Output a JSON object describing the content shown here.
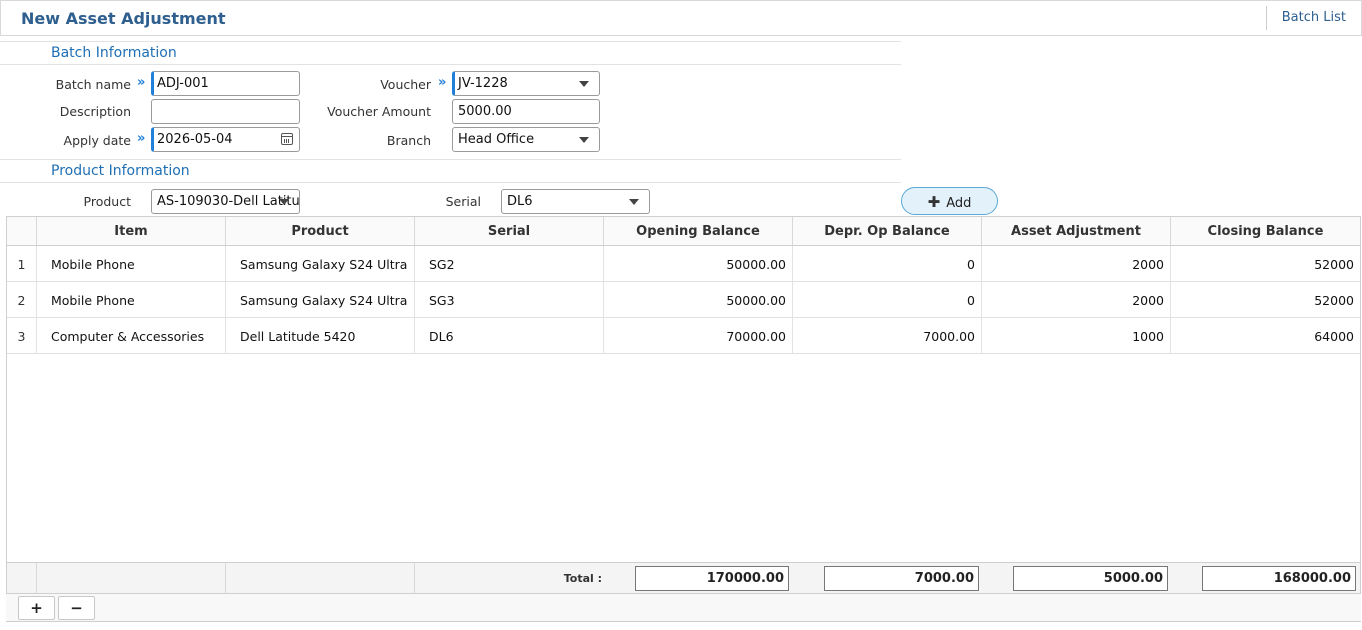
{
  "header": {
    "title": "New Asset Adjustment",
    "batch_list_label": "Batch List"
  },
  "batch_info": {
    "section_title": "Batch Information",
    "batch_name_label": "Batch name",
    "batch_name_value": "ADJ-001",
    "description_label": "Description",
    "description_value": "",
    "apply_date_label": "Apply date",
    "apply_date_value": "2026-05-04",
    "voucher_label": "Voucher",
    "voucher_value": "JV-1228",
    "voucher_amount_label": "Voucher Amount",
    "voucher_amount_value": "5000.00",
    "branch_label": "Branch",
    "branch_value": "Head Office"
  },
  "product_info": {
    "section_title": "Product Information",
    "product_label": "Product",
    "product_value": "AS-109030-Dell Latitu",
    "serial_label": "Serial",
    "serial_value": "DL6",
    "add_label": "Add"
  },
  "grid": {
    "columns": [
      "Item",
      "Product",
      "Serial",
      "Opening Balance",
      "Depr. Op Balance",
      "Asset Adjustment",
      "Closing Balance"
    ],
    "rows": [
      {
        "no": "1",
        "item": "Mobile Phone",
        "product": "Samsung Galaxy S24 Ultra",
        "serial": "SG2",
        "opening": "50000.00",
        "depr": "0",
        "adjustment": "2000",
        "closing": "52000"
      },
      {
        "no": "2",
        "item": "Mobile Phone",
        "product": "Samsung Galaxy S24 Ultra",
        "serial": "SG3",
        "opening": "50000.00",
        "depr": "0",
        "adjustment": "2000",
        "closing": "52000"
      },
      {
        "no": "3",
        "item": "Computer & Accessories",
        "product": "Dell Latitude 5420",
        "serial": "DL6",
        "opening": "70000.00",
        "depr": "7000.00",
        "adjustment": "1000",
        "closing": "64000"
      }
    ],
    "total_label": "Total :",
    "totals": {
      "opening": "170000.00",
      "depr": "7000.00",
      "adjustment": "5000.00",
      "closing": "168000.00"
    }
  },
  "toolbar": {
    "add_row": "+",
    "remove_row": "−"
  },
  "colors": {
    "accent": "#1f7fd9",
    "title": "#2e5f8e",
    "add_button_bg": "#e3f1fb"
  },
  "icons": {
    "required": "double-chevron-right-icon",
    "date": "calendar-icon",
    "dropdown": "caret-down-icon",
    "add": "plus-icon"
  }
}
